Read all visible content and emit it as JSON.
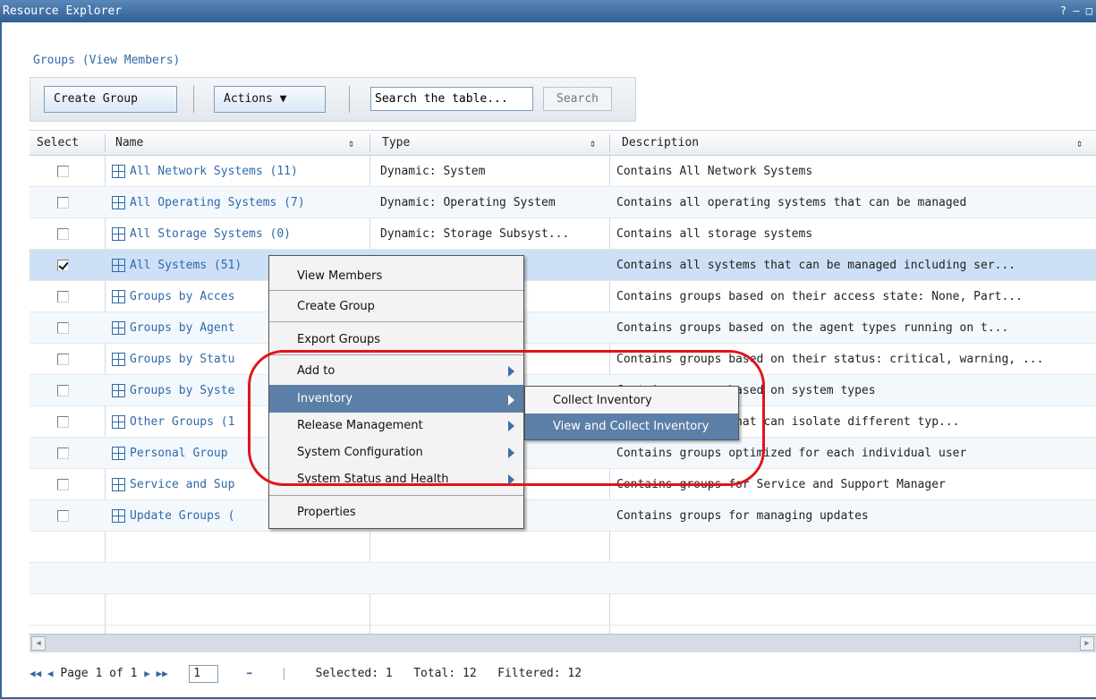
{
  "window": {
    "title": "Resource Explorer",
    "controls": "? – □"
  },
  "section": {
    "title": "Groups (View Members)"
  },
  "toolbar": {
    "create_group": "Create Group",
    "actions": "Actions ▼",
    "search_placeholder": "Search the table...",
    "search_button": "Search"
  },
  "table": {
    "headers": {
      "select": "Select",
      "name": "Name",
      "type": "Type",
      "description": "Description"
    },
    "sort_icon": "⇕",
    "rows": [
      {
        "checked": false,
        "name": "All Network Systems (11)",
        "type": "Dynamic: System",
        "description": "Contains All Network Systems"
      },
      {
        "checked": false,
        "name": "All Operating Systems (7)",
        "type": "Dynamic: Operating System",
        "description": "Contains all operating systems that can be managed"
      },
      {
        "checked": false,
        "name": "All Storage Systems (0)",
        "type": "Dynamic: Storage Subsyst...",
        "description": "Contains all storage systems"
      },
      {
        "checked": true,
        "name": "All Systems (51)",
        "type": "",
        "description": "Contains all systems that can be managed including ser..."
      },
      {
        "checked": false,
        "name": "Groups by Acces",
        "type": "",
        "description": "Contains groups based on their access state: None, Part..."
      },
      {
        "checked": false,
        "name": "Groups by Agent",
        "type": "",
        "description": "Contains groups based on the agent types running on t..."
      },
      {
        "checked": false,
        "name": "Groups by Statu",
        "type": "",
        "description": "Contains groups based on their status: critical, warning, ..."
      },
      {
        "checked": false,
        "name": "Groups by Syste",
        "type": "",
        "description": "Contains groups based on system types"
      },
      {
        "checked": false,
        "name": "Other Groups (1",
        "type": "",
        "description": "Contains groups that can isolate different typ..."
      },
      {
        "checked": false,
        "name": "Personal Group",
        "type": "",
        "description": "Contains groups optimized for each individual user"
      },
      {
        "checked": false,
        "name": "Service and Sup",
        "type": "",
        "description": "Contains groups for Service and Support Manager"
      },
      {
        "checked": false,
        "name": "Update Groups (",
        "type": "",
        "description": "Contains groups for managing updates"
      }
    ]
  },
  "pager": {
    "first_prev": "◀◀ ◀",
    "page_label": "Page 1 of 1",
    "next_last": "▶ ▶▶",
    "page_value": "1",
    "go": "➡",
    "divider": "|",
    "selected": "Selected: 1",
    "total": "Total: 12",
    "filtered": "Filtered: 12"
  },
  "context_menu": {
    "items": [
      {
        "label": "View Members",
        "submenu": false
      },
      {
        "label": "Create Group",
        "submenu": false
      },
      {
        "label": "Export Groups",
        "submenu": false
      },
      {
        "label": "Add to",
        "submenu": true
      },
      {
        "label": "Inventory",
        "submenu": true,
        "highlighted": true
      },
      {
        "label": "Release Management",
        "submenu": true
      },
      {
        "label": "System Configuration",
        "submenu": true
      },
      {
        "label": "System Status and Health",
        "submenu": true
      },
      {
        "label": "Properties",
        "submenu": false
      }
    ]
  },
  "submenu": {
    "items": [
      {
        "label": "Collect Inventory"
      },
      {
        "label": "View and Collect Inventory",
        "highlighted": true
      }
    ]
  },
  "colors": {
    "title_bar": "#3a6597",
    "link": "#2f69a8",
    "menu_highlight": "#5c7fa8",
    "annotation_ring": "#e0141c",
    "selected_row": "#cde0f6"
  }
}
